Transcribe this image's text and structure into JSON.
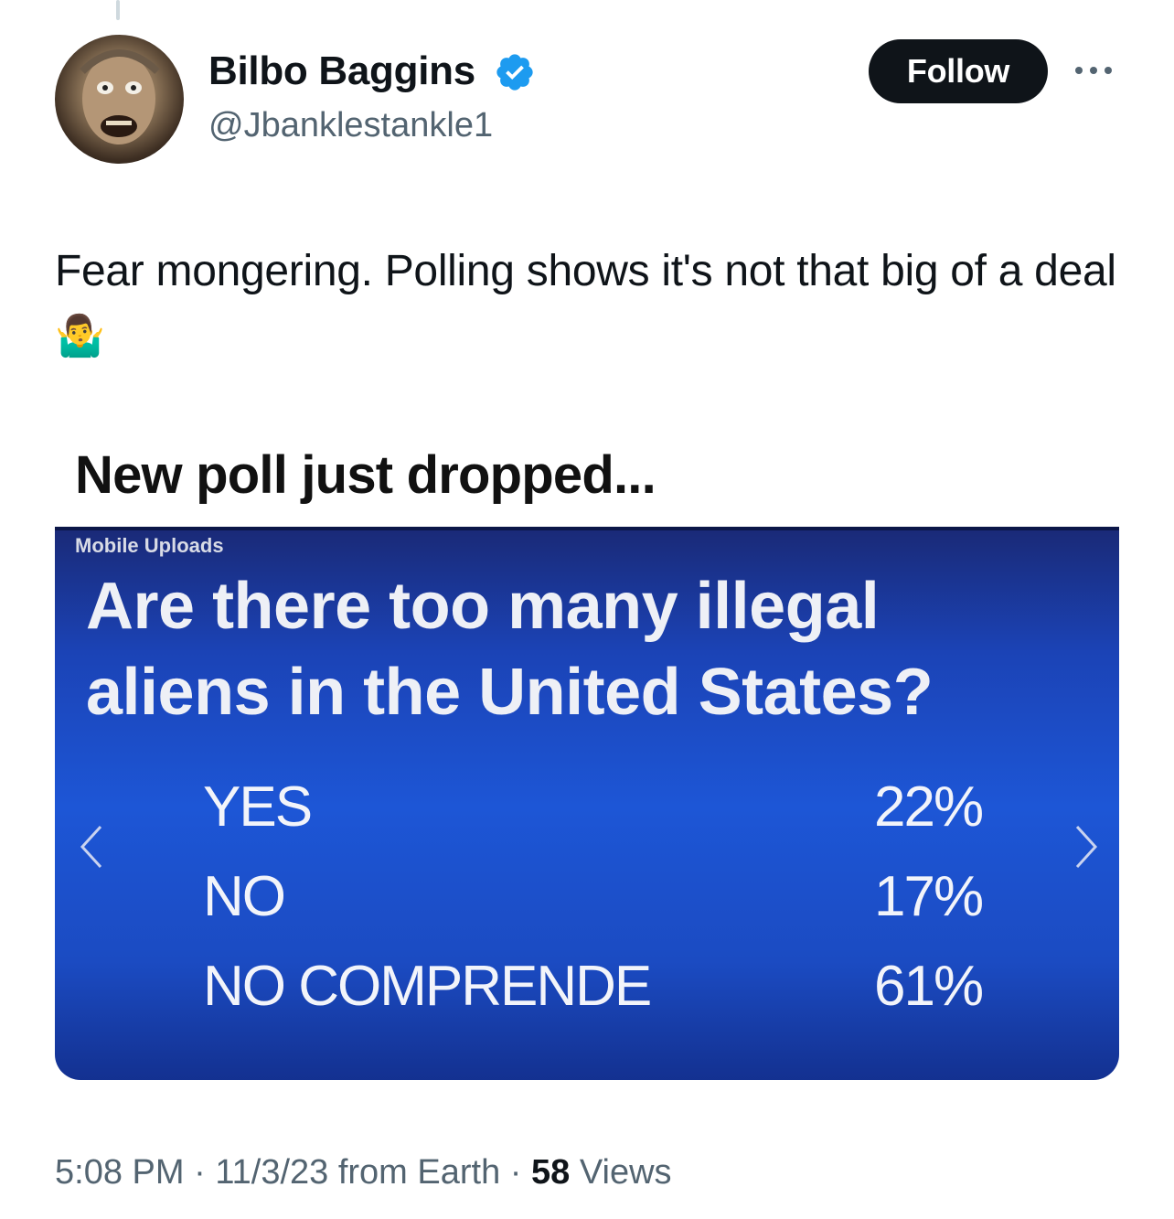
{
  "author": {
    "display_name": "Bilbo Baggins",
    "handle": "@Jbanklestankle1",
    "verified": true,
    "verified_color": "#1d9bf0"
  },
  "actions": {
    "follow_label": "Follow"
  },
  "tweet": {
    "text": "Fear mongering. Polling shows it's not that big of a deal",
    "emoji": "🤷‍♂️"
  },
  "media": {
    "caption": "New poll just dropped...",
    "source_label": "Mobile Uploads",
    "question_line1": "Are there too many illegal",
    "question_line2": "aliens in the United States?",
    "options": [
      {
        "label": "YES",
        "value": "22%"
      },
      {
        "label": "NO",
        "value": "17%"
      },
      {
        "label": "NO COMPRENDE",
        "value": "61%"
      }
    ],
    "screen_color": "#1d56d6"
  },
  "meta": {
    "time": "5:08 PM",
    "separator": " · ",
    "date_source": "11/3/23 from Earth",
    "views_count": "58",
    "views_label": "Views"
  },
  "icons": {
    "verified": "verified-badge-icon",
    "more": "more-horizontal-icon",
    "prev": "chevron-left-icon",
    "next": "chevron-right-icon"
  }
}
